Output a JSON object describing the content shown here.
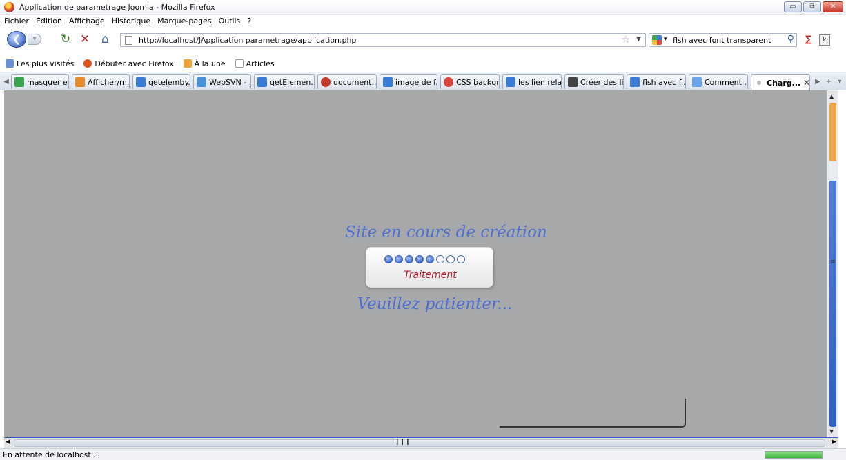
{
  "window": {
    "title": "Application de parametrage Joomla - Mozilla Firefox",
    "buttons": [
      "▭",
      "⧉",
      "✕"
    ]
  },
  "menu": [
    "Fichier",
    "Édition",
    "Affichage",
    "Historique",
    "Marque-pages",
    "Outils",
    "?"
  ],
  "nav": {
    "url": "http://localhost/JApplication parametrage/application.php",
    "search_text": "flsh avec font transparent"
  },
  "bookmarks": [
    {
      "label": "Les plus visités",
      "color": "#6b8fd6"
    },
    {
      "label": "Débuter avec Firefox",
      "color": "#e0521b"
    },
    {
      "label": "À la une",
      "color": "#f2a23a"
    },
    {
      "label": "Articles",
      "color": "#ffffff"
    }
  ],
  "tabs": [
    {
      "label": "masquer et...",
      "color": "#3da353"
    },
    {
      "label": "Afficher/m...",
      "color": "#e98a2a"
    },
    {
      "label": "getelemby...",
      "color": "#3a7bd5"
    },
    {
      "label": "WebSVN - ...",
      "color": "#4a90d9"
    },
    {
      "label": "getElemen...",
      "color": "#3a7bd5"
    },
    {
      "label": "document....",
      "color": "#c0392b"
    },
    {
      "label": "image de f...",
      "color": "#3a7bd5"
    },
    {
      "label": "CSS backgr...",
      "color": "#d6453d"
    },
    {
      "label": "les lien rela...",
      "color": "#3a7bd5"
    },
    {
      "label": "Créer des li...",
      "color": "#444444"
    },
    {
      "label": "flsh avec f...",
      "color": "#3a7bd5"
    },
    {
      "label": "Comment ...",
      "color": "#6da6e8"
    },
    {
      "label": "Charg...",
      "color": "#888888",
      "active": true
    }
  ],
  "page": {
    "heading": "Site en cours de création",
    "loader_text": "Traitement",
    "loader_progress": {
      "filled": 5,
      "total": 8
    },
    "footer_text": "Veuillez patienter..."
  },
  "status": {
    "text": "En attente de localhost...",
    "progress": 1.0
  },
  "colors": {
    "page_bg": "#a7a8aa",
    "heading": "#4d6fd3",
    "loader_text": "#b51c24"
  }
}
